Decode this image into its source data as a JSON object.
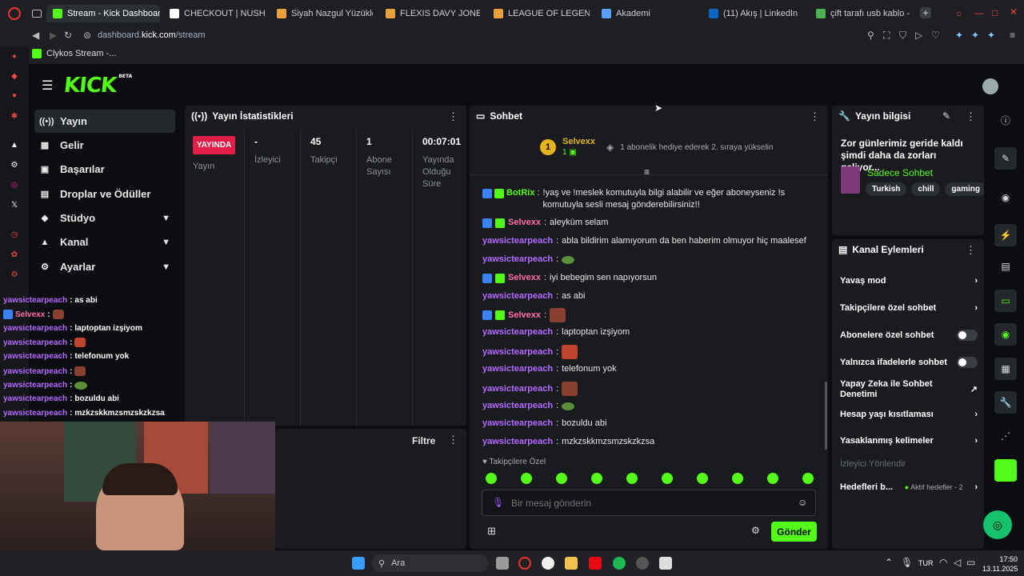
{
  "browser": {
    "tabs": [
      {
        "label": "Stream - Kick Dashboard",
        "color": "#53fc18"
      },
      {
        "label": "CHECKOUT | NUSHİ",
        "color": "#ffffff"
      },
      {
        "label": "Siyah Nazgul Yüzükleri",
        "color": "#e9a23b"
      },
      {
        "label": "FLEXIS DAVY JONES K",
        "color": "#e9a23b"
      },
      {
        "label": "LEAGUE OF LEGENDS",
        "color": "#e9a23b"
      },
      {
        "label": "Akademi",
        "color": "#5aa0ff"
      },
      {
        "label": "(11) Akış | LinkedIn",
        "color": "#0a66c2"
      },
      {
        "label": "çift tarafı usb kablo - G",
        "color": "#4caf50"
      }
    ],
    "url_prefix": "dashboard.",
    "url_domain": "kick.com",
    "url_path": "/stream",
    "bookmark": "Clykos Stream -..."
  },
  "sidebar": {
    "items": [
      {
        "label": "Yayın",
        "icon": "broadcast-icon"
      },
      {
        "label": "Gelir",
        "icon": "revenue-icon"
      },
      {
        "label": "Başarılar",
        "icon": "achievement-icon"
      },
      {
        "label": "Droplar ve Ödüller",
        "icon": "gift-icon"
      },
      {
        "label": "Stüdyo",
        "icon": "studio-icon"
      },
      {
        "label": "Kanal",
        "icon": "channel-icon"
      },
      {
        "label": "Ayarlar",
        "icon": "gear-icon"
      }
    ]
  },
  "stats": {
    "title": "Yayın İstatistikleri",
    "live_label": "YAYINDA",
    "items": [
      {
        "value": "",
        "label": "Yayın"
      },
      {
        "value": "-",
        "label": "İzleyici"
      },
      {
        "value": "45",
        "label": "Takipçi"
      },
      {
        "value": "1",
        "label": "Abone Sayısı"
      },
      {
        "value": "00:07:01",
        "label": "Yayında Olduğu Süre"
      }
    ],
    "filter_label": "Filtre"
  },
  "overlay_chat": [
    {
      "user": "yawsictearpeach",
      "text": "as abi",
      "emote": ""
    },
    {
      "user": "Selvexx",
      "text": "",
      "emote": "emote"
    },
    {
      "user": "yawsictearpeach",
      "text": "laptoptan izşiyom",
      "emote": ""
    },
    {
      "user": "yawsictearpeach",
      "text": "",
      "emote": "emote"
    },
    {
      "user": "yawsictearpeach",
      "text": "telefonum yok",
      "emote": ""
    },
    {
      "user": "yawsictearpeach",
      "text": "",
      "emote": "emote"
    },
    {
      "user": "yawsictearpeach",
      "text": "",
      "emote": "emote"
    },
    {
      "user": "yawsictearpeach",
      "text": "bozuldu abi",
      "emote": ""
    },
    {
      "user": "yawsictearpeach",
      "text": "mzkzskkmzsmzskzkzsa",
      "emote": ""
    }
  ],
  "chat": {
    "title": "Sohbet",
    "gifter_name": "Selvexx",
    "gifter_count": "1",
    "gifter_rank": "1",
    "gift_message": "1 abonelik hediye ederek 2. sıraya yükselin",
    "messages": [
      {
        "user": "BotRix",
        "text": "!yaş ve !meslek komutuyla bilgi alabilir ve eğer aboneyseniz !s komutuyla sesli mesaj gönderebilirsiniz!!"
      },
      {
        "user": "Selvexx",
        "text": "aleyküm selam"
      },
      {
        "user": "yawsictearpeach",
        "text": "abla bildirim alamıyorum da ben haberim olmuyor hiç maalesef"
      },
      {
        "user": "yawsictearpeach",
        "text": ""
      },
      {
        "user": "Selvexx",
        "text": "iyi bebegim sen napıyorsun"
      },
      {
        "user": "yawsictearpeach",
        "text": "as abi"
      },
      {
        "user": "Selvexx",
        "text": ""
      },
      {
        "user": "yawsictearpeach",
        "text": "laptoptan izşiyom"
      },
      {
        "user": "yawsictearpeach",
        "text": ""
      },
      {
        "user": "yawsictearpeach",
        "text": "telefonum yok"
      },
      {
        "user": "yawsictearpeach",
        "text": ""
      },
      {
        "user": "yawsictearpeach",
        "text": ""
      },
      {
        "user": "yawsictearpeach",
        "text": "bozuldu abi"
      },
      {
        "user": "yawsictearpeach",
        "text": "mzkzskkmzsmzskzkzsa"
      }
    ],
    "followers_only_label": "Takipçilere Özel",
    "input_placeholder": "Bir mesaj gönderin",
    "send_label": "Gönder"
  },
  "stream_info": {
    "title": "Yayın bilgisi",
    "stream_title": "Zor günlerimiz geride kaldı şimdi daha da zorları geliyor...",
    "category": "Sadece Sohbet",
    "tags": [
      "Turkish",
      "chill",
      "gaming"
    ]
  },
  "channel_actions": {
    "title": "Kanal Eylemleri",
    "items": [
      {
        "label": "Yavaş mod",
        "control": "chevron"
      },
      {
        "label": "Takipçilere özel sohbet",
        "control": "chevron"
      },
      {
        "label": "Abonelere özel sohbet",
        "control": "toggle"
      },
      {
        "label": "Yalnızca ifadelerle sohbet",
        "control": "toggle"
      },
      {
        "label": "Yapay Zeka ile Sohbet Denetimi",
        "control": "external"
      },
      {
        "label": "Hesap yaşı kısıtlaması",
        "control": "chevron"
      },
      {
        "label": "Yasaklanmış kelimeler",
        "control": "chevron"
      },
      {
        "label": "İzleyici Yönlendir",
        "control": "none"
      },
      {
        "label": "Hedefleri b...",
        "control": "chevron"
      }
    ],
    "goals_status": "Aktif hedefler - 2"
  },
  "taskbar": {
    "search_placeholder": "Ara",
    "language": "TUR",
    "time": "17:50",
    "date": "13.11.2025"
  },
  "colors": {
    "brand": "#53fc18",
    "live": "#e11d48",
    "username": "#b36bff",
    "username_sub": "#ff6ea1"
  }
}
